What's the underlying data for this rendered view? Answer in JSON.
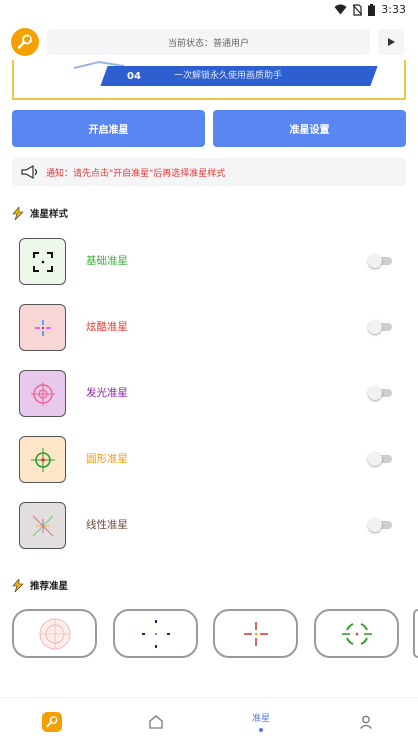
{
  "status_bar": {
    "time": "3:33"
  },
  "header": {
    "status_text": "当前状态：普通用户"
  },
  "banner": {
    "badge": "04",
    "text": "一次解锁永久使用画质助手"
  },
  "actions": {
    "open_label": "开启准星",
    "settings_label": "准星设置"
  },
  "notice": {
    "text": "通知：请先点击\"开启准星\"后再选择准星样式"
  },
  "sections": {
    "styles_title": "准星样式",
    "recommend_title": "推荐准星"
  },
  "styles": [
    {
      "label": "基础准星",
      "color": "#3bb03b",
      "bg": "#eef8ea",
      "enabled": false
    },
    {
      "label": "炫酷准星",
      "color": "#e53935",
      "bg": "#f9d6d6",
      "enabled": false
    },
    {
      "label": "发光准星",
      "color": "#8e24aa",
      "bg": "#e6c9ec",
      "enabled": false
    },
    {
      "label": "圆形准星",
      "color": "#f29a12",
      "bg": "#fde6c8",
      "enabled": false
    },
    {
      "label": "线性准星",
      "color": "#6d4c41",
      "bg": "#e2dede",
      "enabled": false
    }
  ],
  "bottom_nav": {
    "active_label": "准星"
  },
  "colors": {
    "accent": "#5a86f1",
    "logo": "#f4a100",
    "notice": "#e53935"
  }
}
